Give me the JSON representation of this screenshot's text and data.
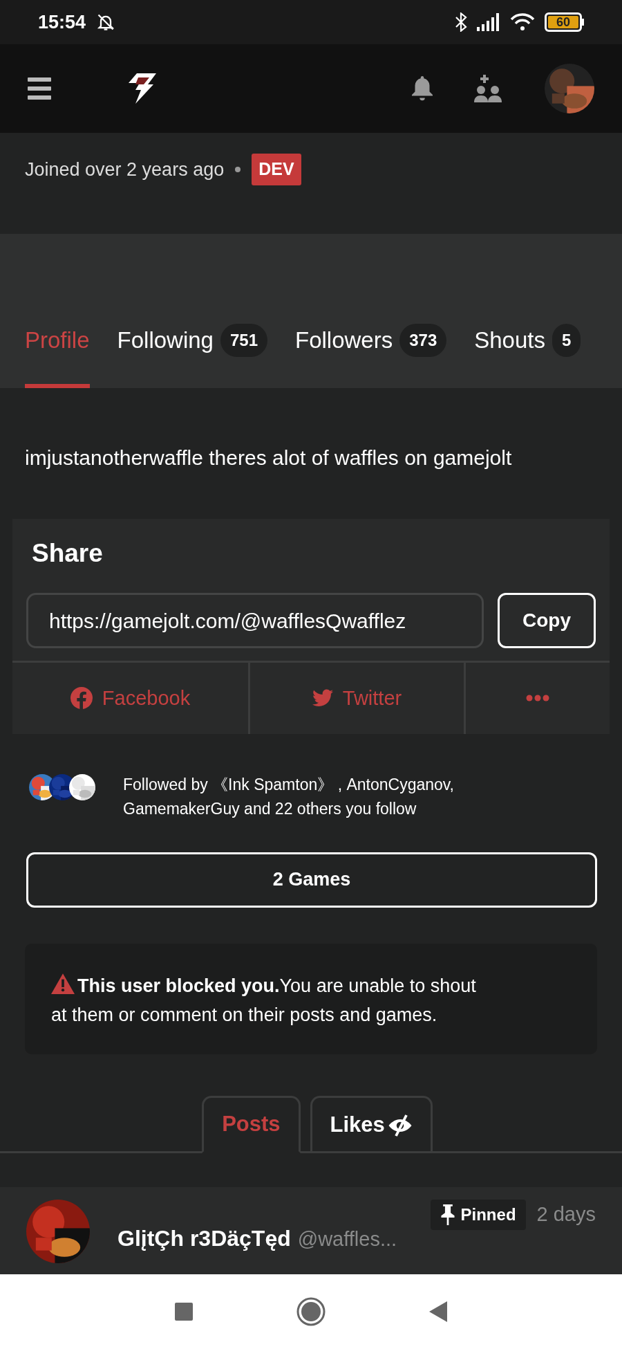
{
  "status_bar": {
    "time": "15:54",
    "battery": "60"
  },
  "profile": {
    "joined": "Joined over 2 years ago",
    "badge": "DEV"
  },
  "tabs": [
    {
      "label": "Profile",
      "selected": true
    },
    {
      "label": "Following",
      "count": "751",
      "selected": false
    },
    {
      "label": "Followers",
      "count": "373",
      "selected": false
    },
    {
      "label": "Shouts",
      "count": "5",
      "selected": false
    }
  ],
  "bio": "imjustanotherwaffle theres alot of waffles on gamejolt",
  "share": {
    "title": "Share",
    "url": "https://gamejolt.com/@wafflesQwafflez",
    "copy_button": "Copy",
    "options": [
      {
        "kind": "facebook",
        "label": "Facebook"
      },
      {
        "kind": "twitter",
        "label": "Twitter"
      },
      {
        "kind": "more"
      }
    ]
  },
  "followed_by": "Followed by 《Ink Spamton》 , AntonCyganov, GamemakerGuy and 22 others you follow",
  "games_button": "2 Games",
  "notice": "**This user blocked you.**You are unable to shout at them or comment on their posts and games.",
  "post_tabs": [
    {
      "label": "Posts",
      "selected": true,
      "private": false
    },
    {
      "label": "Likes",
      "selected": false,
      "private": true
    }
  ],
  "post": {
    "author": "GlįtÇh r3DäçTęd",
    "handle": "@waffles...",
    "pinned": "Pinned",
    "time": "2 days"
  }
}
